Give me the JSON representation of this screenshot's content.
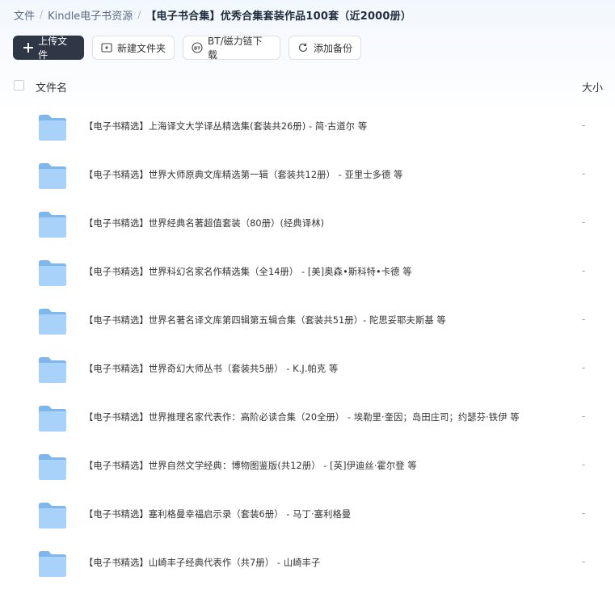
{
  "breadcrumb": {
    "root": "文件",
    "parent": "Kindle电子书资源",
    "current": "【电子书合集】优秀合集套装作品100套（近2000册）"
  },
  "toolbar": {
    "upload_label": "上传文件",
    "new_folder_label": "新建文件夹",
    "bt_label": "BT/磁力链下载",
    "backup_label": "添加备份"
  },
  "list_header": {
    "name": "文件名",
    "size": "大小"
  },
  "files": [
    {
      "name": "【电子书精选】上海译文大学译丛精选集(套装共26册) - 简·古道尔 等",
      "size": "-"
    },
    {
      "name": "【电子书精选】世界大师原典文库精选第一辑（套装共12册） - 亚里士多德 等",
      "size": "-"
    },
    {
      "name": "【电子书精选】世界经典名著超值套装（80册）(经典译林)",
      "size": "-"
    },
    {
      "name": "【电子书精选】世界科幻名家名作精选集（全14册） - [美]奥森•斯科特•卡德 等",
      "size": "-"
    },
    {
      "name": "【电子书精选】世界名著名译文库第四辑第五辑合集（套装共51册）- 陀思妥耶夫斯基  等",
      "size": "-"
    },
    {
      "name": "【电子书精选】世界奇幻大师丛书（套装共5册） - K.J.帕克 等",
      "size": "-"
    },
    {
      "name": "【电子书精选】世界推理名家代表作：高阶必读合集（20全册） - 埃勒里·奎因；岛田庄司；约瑟芬·铁伊 等",
      "size": "-"
    },
    {
      "name": "【电子书精选】世界自然文学经典：博物图鉴版(共12册） - [英]伊迪丝·霍尔登 等",
      "size": "-"
    },
    {
      "name": "【电子书精选】塞利格曼幸福启示录（套装6册） - 马丁·塞利格曼",
      "size": "-"
    },
    {
      "name": "【电子书精选】山崎丰子经典代表作（共7册） - 山崎丰子",
      "size": "-"
    }
  ]
}
